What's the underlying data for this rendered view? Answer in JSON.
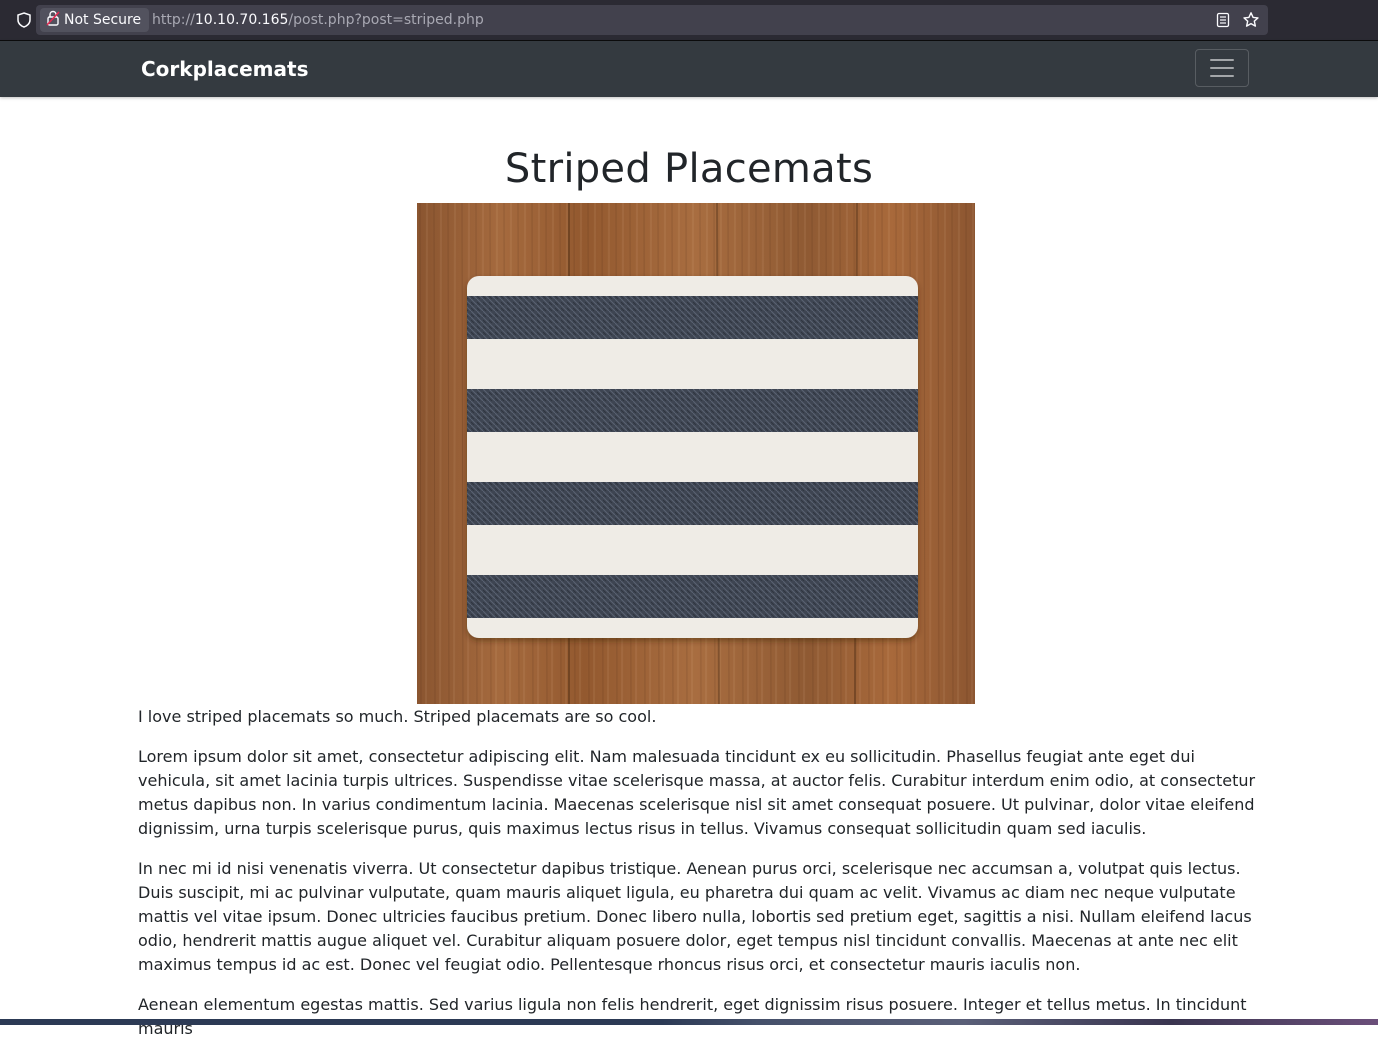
{
  "browser": {
    "security_label": "Not Secure",
    "url_prefix": "http://",
    "url_host": "10.10.70.165",
    "url_path": "/post.php?post=striped.php",
    "icons": [
      "shield-icon",
      "insecure-lock-icon",
      "reader-view-icon",
      "bookmark-star-icon"
    ]
  },
  "navbar": {
    "brand": "Corkplacemats",
    "toggler_icon": "hamburger-menu-icon",
    "background": "#343a40"
  },
  "post": {
    "title": "Striped Placemats",
    "image_alt": "striped placemat on wooden table",
    "intro": "I love striped placemats so much. Striped placemats are so cool.",
    "paragraphs": [
      "Lorem ipsum dolor sit amet, consectetur adipiscing elit. Nam malesuada tincidunt ex eu sollicitudin. Phasellus feugiat ante eget dui vehicula, sit amet lacinia turpis ultrices. Suspendisse vitae scelerisque massa, at auctor felis. Curabitur interdum enim odio, at consectetur metus dapibus non. In varius condimentum lacinia. Maecenas scelerisque nisl sit amet consequat posuere. Ut pulvinar, dolor vitae eleifend dignissim, urna turpis scelerisque purus, quis maximus lectus risus in tellus. Vivamus consequat sollicitudin quam sed iaculis.",
      "In nec mi id nisi venenatis viverra. Ut consectetur dapibus tristique. Aenean purus orci, scelerisque nec accumsan a, volutpat quis lectus. Duis suscipit, mi ac pulvinar vulputate, quam mauris aliquet ligula, eu pharetra dui quam ac velit. Vivamus ac diam nec neque vulputate mattis vel vitae ipsum. Donec ultricies faucibus pretium. Donec libero nulla, lobortis sed pretium eget, sagittis a nisi. Nullam eleifend lacus odio, hendrerit mattis augue aliquet vel. Curabitur aliquam posuere dolor, eget tempus nisl tincidunt convallis. Maecenas at ante nec elit maximus tempus id ac est. Donec vel feugiat odio. Pellentesque rhoncus risus orci, et consectetur mauris iaculis non.",
      "Aenean elementum egestas mattis. Sed varius ligula non felis hendrerit, eget dignissim risus posuere. Integer et tellus metus. In tincidunt mauris"
    ]
  },
  "colors": {
    "wood": "#9a6238",
    "stripe_dark": "#3d4451",
    "stripe_light": "#efece6"
  }
}
